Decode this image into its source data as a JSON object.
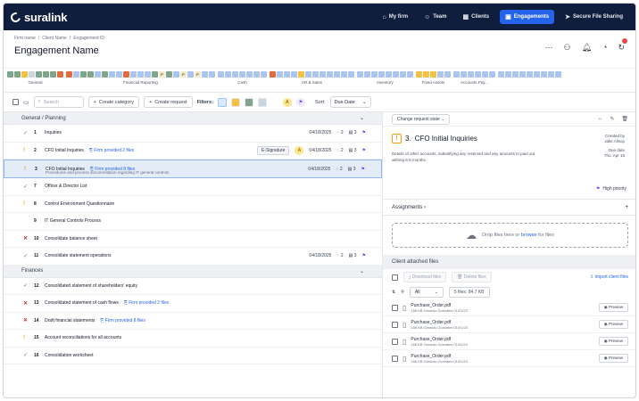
{
  "brand": {
    "name": "suralink"
  },
  "nav": [
    {
      "label": "My firm",
      "icon": "home-icon",
      "glyph": "⌂",
      "active": false
    },
    {
      "label": "Team",
      "icon": "team-icon",
      "glyph": "☺",
      "active": false
    },
    {
      "label": "Clients",
      "icon": "clients-icon",
      "glyph": "▦",
      "active": false
    },
    {
      "label": "Engagements",
      "icon": "engagements-icon",
      "glyph": "▣",
      "active": true
    },
    {
      "label": "Secure File Sharing",
      "icon": "send-icon",
      "glyph": "➤",
      "active": false
    }
  ],
  "breadcrumb": [
    "Firm name",
    "Client Name",
    "Engagement ID"
  ],
  "page_title": "Engagement Name",
  "sections": [
    {
      "label": "General",
      "cells": [
        "g",
        "g",
        "y",
        "gy",
        "g",
        "g",
        "g",
        "o"
      ]
    },
    {
      "label": "Financial Reporting",
      "cells": [
        "o",
        "b",
        "g",
        "g",
        "b",
        "g",
        "b",
        "b",
        "o",
        "b",
        "b",
        "b",
        "g",
        "p",
        "g",
        "b",
        "p",
        "b",
        "p",
        "b",
        "b"
      ]
    },
    {
      "label": "Cash",
      "cells": [
        "b",
        "b",
        "b",
        "b",
        "b",
        "b",
        "b"
      ]
    },
    {
      "label": "AR & Sales",
      "cells": [
        "o",
        "b",
        "b",
        "b",
        "y",
        "b",
        "b",
        "b",
        "b",
        "b",
        "b",
        "b"
      ]
    },
    {
      "label": "Inventory",
      "cells": [
        "b",
        "b",
        "b",
        "b",
        "b",
        "b",
        "b",
        "b"
      ]
    },
    {
      "label": "Fixed Assets",
      "cells": [
        "y",
        "y",
        "y",
        "b",
        "b"
      ]
    },
    {
      "label": "Accounts Pay...",
      "cells": [
        "b",
        "b",
        "b",
        "b",
        "b",
        "b"
      ]
    },
    {
      "label": "",
      "cells": [
        "b",
        "b",
        "b",
        "b",
        "b",
        "b",
        "b",
        "b",
        "b"
      ]
    }
  ],
  "toolbar": {
    "search_placeholder": "Search",
    "create_category": "Create category",
    "create_request": "Create request",
    "filters_label": "Filters:",
    "sort_label": "Sort:",
    "sort_value": "Due Date",
    "avatar_a": "A",
    "avatar_p": "P"
  },
  "groups": [
    {
      "name": "General / Planning",
      "rows": [
        {
          "status": "ok",
          "num": "1",
          "name": "Inquiries",
          "date": "04/18/2025",
          "c1": "2",
          "c2": "3"
        },
        {
          "status": "warn",
          "num": "2",
          "name": "CFO Initial Inquiries",
          "link": "Firm provided 2 files",
          "esig": "E-Signature",
          "avatar": "A",
          "date": "04/18/2025",
          "c1": "2",
          "c2": "3"
        },
        {
          "status": "warn",
          "num": "3",
          "name": "CFO Initial Inquiries",
          "link": "Firm provided 8 files",
          "sub": "Procedures and process documentation regarding IT general controls",
          "date": "04/18/2025",
          "c1": "2",
          "c2": "3",
          "selected": true
        },
        {
          "status": "ok",
          "num": "7",
          "name": "Officer & Director List"
        },
        {
          "status": "warn",
          "num": "8",
          "name": "Control Environment Questionnaire"
        },
        {
          "status": "none",
          "num": "9",
          "name": "IT General Controls Process"
        },
        {
          "status": "x",
          "num": "10",
          "name": "Consolidate balance sheet"
        },
        {
          "status": "ok",
          "num": "11",
          "name": "Consolidate statement operations",
          "date": "04/18/2025",
          "c1": "2",
          "c2": "3"
        }
      ]
    },
    {
      "name": "Finances",
      "rows": [
        {
          "status": "ok",
          "num": "12",
          "name": "Consolidated statement of shareholders' equity"
        },
        {
          "status": "x",
          "num": "13",
          "name": "Consolidated statement of cash flows",
          "link": "Firm provided 2 files"
        },
        {
          "status": "x",
          "num": "14",
          "name": "Draft financial statements",
          "link": "Firm provided 8 files"
        },
        {
          "status": "warn",
          "num": "15",
          "name": "Account reconciliations for all accounts"
        },
        {
          "status": "ok",
          "num": "16",
          "name": "Consolidation worksheet"
        }
      ]
    }
  ],
  "detail": {
    "state_dropdown": "Change request state",
    "num": "3.",
    "title": "CFO Initial Inquiries",
    "desc": "Details of other accounts, indentifying any reserved and any amounts to paid out withing 6-8 months.",
    "created_by_label": "Created by",
    "created_by": "Jake Allsop",
    "due_label": "Due date",
    "due": "Thu, Apr 16",
    "priority": "High priority",
    "assignments": "Assignments",
    "drop_text_a": "Drop files here or ",
    "drop_link": "browse",
    "drop_text_b": " for files"
  },
  "client_files": {
    "heading": "Client attached files",
    "download": "Download files",
    "delete": "Delete files",
    "import": "Import client files",
    "filter": "All",
    "count": "5 files: 84.7 KB",
    "files": [
      {
        "name": "Purchase_Order.pdf",
        "meta": "158 KB  Gerardo Gonzalez  01/01/23"
      },
      {
        "name": "Purchase_Order.pdf",
        "meta": "158 KB  Gerardo Gonzalez  01/01/23"
      },
      {
        "name": "Purchase_Order.pdf",
        "meta": "158 KB  Gerardo Gonzalez  01/01/23"
      },
      {
        "name": "Purchase_Order.pdf",
        "meta": "158 KB  Gerardo Gonzalez  01/01/23"
      }
    ],
    "preview": "Preview"
  }
}
